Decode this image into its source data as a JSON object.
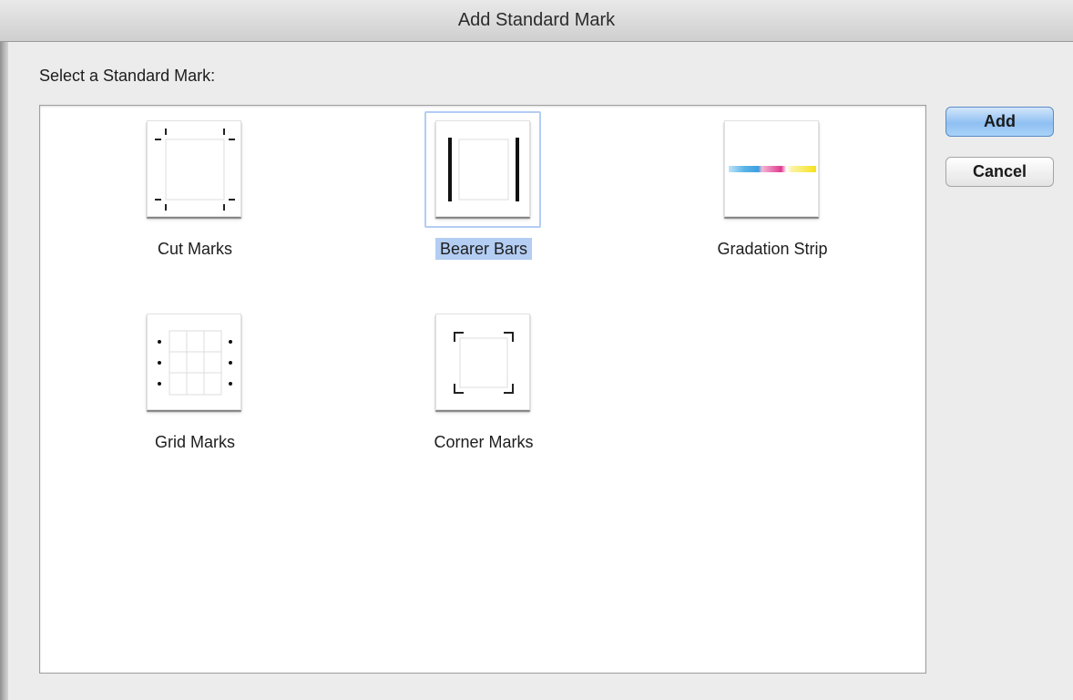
{
  "window": {
    "title": "Add Standard Mark"
  },
  "prompt": "Select a Standard Mark:",
  "marks": [
    {
      "label": "Cut Marks",
      "icon": "cut-marks-icon",
      "selected": false
    },
    {
      "label": "Bearer Bars",
      "icon": "bearer-bars-icon",
      "selected": true
    },
    {
      "label": "Gradation Strip",
      "icon": "gradation-strip-icon",
      "selected": false
    },
    {
      "label": "Grid Marks",
      "icon": "grid-marks-icon",
      "selected": false
    },
    {
      "label": "Corner Marks",
      "icon": "corner-marks-icon",
      "selected": false
    }
  ],
  "buttons": {
    "add": "Add",
    "cancel": "Cancel"
  },
  "colors": {
    "selection": "#b3cdf3",
    "default_button": "#8fbff2",
    "gradation": [
      "#5ab4e8",
      "#e0398f",
      "#f6e21a"
    ]
  }
}
